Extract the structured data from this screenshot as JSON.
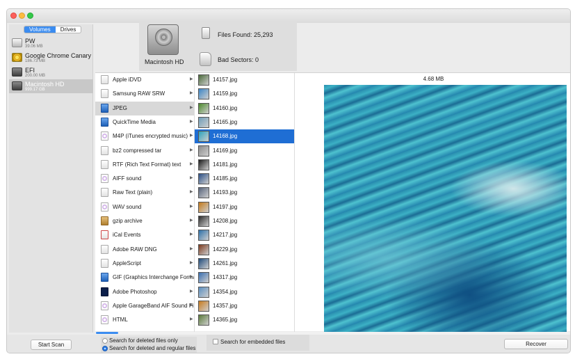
{
  "sidebar": {
    "tabs": [
      "Volumes",
      "Drives"
    ],
    "volumes": [
      {
        "name": "PW",
        "size": "39.06 MB"
      },
      {
        "name": "Google Chrome Canary",
        "size": "186.73 MB"
      },
      {
        "name": "EFI",
        "size": "200.00 MB"
      },
      {
        "name": "Macintosh HD",
        "size": "999.17 GB"
      }
    ]
  },
  "header": {
    "disk_label": "Macintosh HD",
    "files_found": "Files Found:  25,293",
    "bad_sectors": "Bad Sectors: 0"
  },
  "file_types": [
    {
      "label": "Apple iDVD",
      "icon": "document-icon"
    },
    {
      "label": "Samsung RAW SRW",
      "icon": "document-icon"
    },
    {
      "label": "JPEG",
      "icon": "image-icon"
    },
    {
      "label": "QuickTime Media",
      "icon": "quicktime-icon"
    },
    {
      "label": "M4P (iTunes encrypted music)",
      "icon": "music-icon"
    },
    {
      "label": "bz2 compressed tar",
      "icon": "document-icon"
    },
    {
      "label": "RTF (Rich Text Format) text",
      "icon": "text-icon"
    },
    {
      "label": "AIFF sound",
      "icon": "music-icon"
    },
    {
      "label": "Raw Text (plain)",
      "icon": "text-icon"
    },
    {
      "label": "WAV sound",
      "icon": "music-icon"
    },
    {
      "label": "gzip archive",
      "icon": "archive-icon"
    },
    {
      "label": "iCal Events",
      "icon": "calendar-icon"
    },
    {
      "label": "Adobe RAW DNG",
      "icon": "document-icon"
    },
    {
      "label": "AppleScript",
      "icon": "script-icon"
    },
    {
      "label": "GIF (Graphics Interchange Format)",
      "icon": "image-icon"
    },
    {
      "label": "Adobe Photoshop",
      "icon": "photoshop-icon"
    },
    {
      "label": "Apple GarageBand AIF Sound Files",
      "icon": "music-icon"
    },
    {
      "label": "HTML",
      "icon": "chrome-icon"
    }
  ],
  "files": [
    {
      "name": "14157.jpg",
      "color": "#4a6a3a"
    },
    {
      "name": "14159.jpg",
      "color": "#3b85c6"
    },
    {
      "name": "14160.jpg",
      "color": "#4b8a2c"
    },
    {
      "name": "14165.jpg",
      "color": "#6e9db8"
    },
    {
      "name": "14168.jpg",
      "color": "#2ba3bd"
    },
    {
      "name": "14169.jpg",
      "color": "#8a8a8a"
    },
    {
      "name": "14181.jpg",
      "color": "#1a1a1a"
    },
    {
      "name": "14185.jpg",
      "color": "#2a4e85"
    },
    {
      "name": "14193.jpg",
      "color": "#56637a"
    },
    {
      "name": "14197.jpg",
      "color": "#c47a1a"
    },
    {
      "name": "14208.jpg",
      "color": "#2a2a2a"
    },
    {
      "name": "14217.jpg",
      "color": "#2b6fa8"
    },
    {
      "name": "14229.jpg",
      "color": "#7b3a1e"
    },
    {
      "name": "14261.jpg",
      "color": "#1f4a7a"
    },
    {
      "name": "14317.jpg",
      "color": "#3a6fb0"
    },
    {
      "name": "14354.jpg",
      "color": "#5b8fc0"
    },
    {
      "name": "14357.jpg",
      "color": "#c87b1e"
    },
    {
      "name": "14365.jpg",
      "color": "#5a7a3a"
    }
  ],
  "selected_type": 2,
  "selected_file": 4,
  "preview": {
    "size": "4.68 MB"
  },
  "bottom": {
    "start_scan": "Start Scan",
    "search_deleted_only": "Search for deleted files only",
    "search_deleted_regular": "Search for deleted and regular files",
    "search_embedded": "Search for embedded files",
    "recover": "Recover"
  }
}
